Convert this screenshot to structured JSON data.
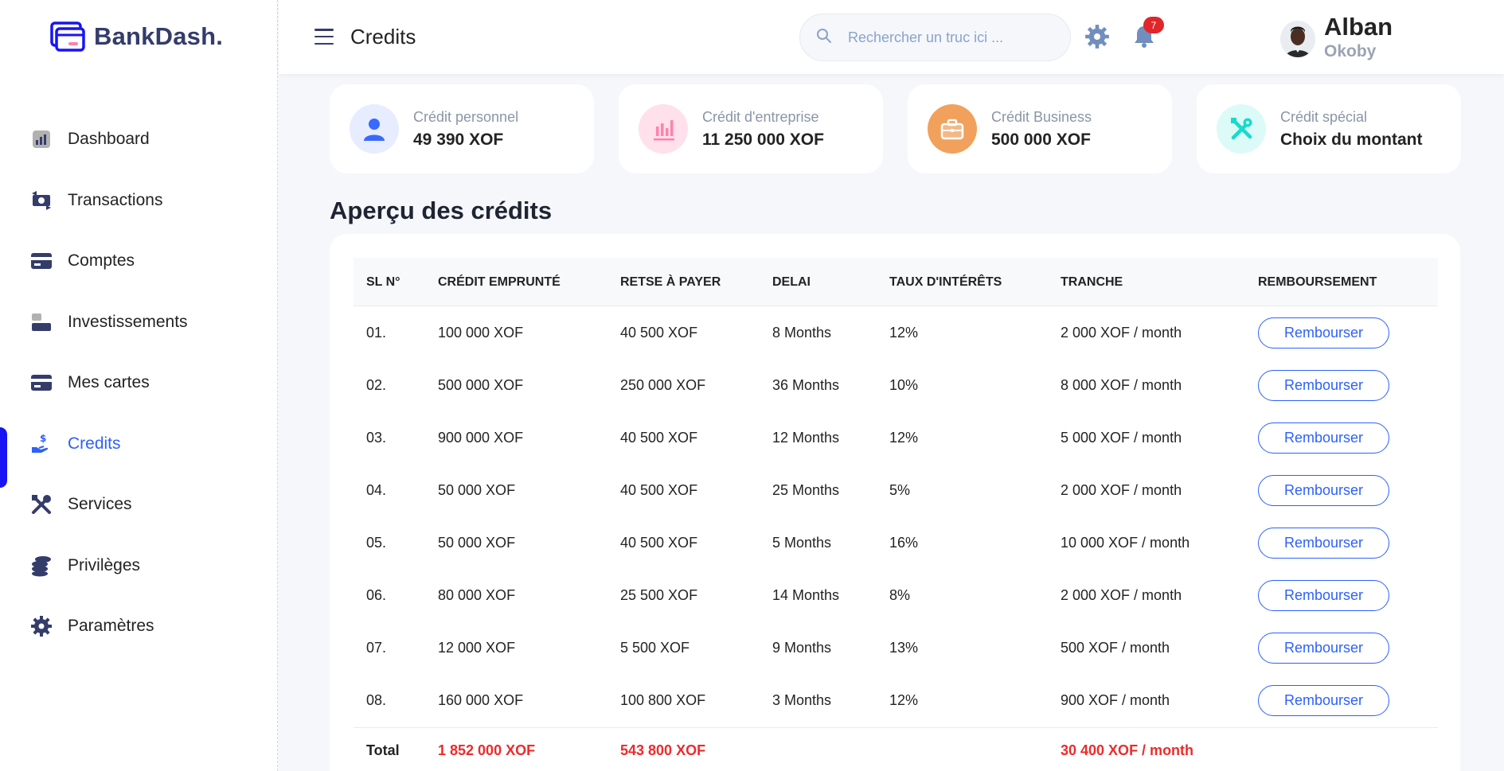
{
  "app": {
    "name": "BankDash."
  },
  "sidebar": {
    "items": [
      {
        "label": "Dashboard",
        "icon": "dashboard-icon"
      },
      {
        "label": "Transactions",
        "icon": "transactions-icon"
      },
      {
        "label": "Comptes",
        "icon": "accounts-icon"
      },
      {
        "label": "Investissements",
        "icon": "investments-icon"
      },
      {
        "label": "Mes cartes",
        "icon": "credit-card-icon"
      },
      {
        "label": "Credits",
        "icon": "loan-icon",
        "active": true
      },
      {
        "label": "Services",
        "icon": "services-icon"
      },
      {
        "label": "Privilèges",
        "icon": "privileges-icon"
      },
      {
        "label": "Paramètres",
        "icon": "settings-icon"
      }
    ]
  },
  "header": {
    "title": "Credits",
    "search_placeholder": "Rechercher un truc ici ...",
    "notification_count": "7",
    "user": {
      "first_name": "Alban",
      "last_name": "Okoby"
    }
  },
  "cards": [
    {
      "label": "Crédit personnel",
      "value": "49 390 XOF",
      "icon": "user-icon",
      "icon_bg": "#e7edff",
      "icon_color": "#396aff"
    },
    {
      "label": "Crédit d'entreprise",
      "value": "11 250 000 XOF",
      "icon": "bar-chart-icon",
      "icon_bg": "#ffe0eb",
      "icon_color": "#ff82ac"
    },
    {
      "label": "Crédit Business",
      "value": "500 000 XOF",
      "icon": "briefcase-icon",
      "icon_bg": "#f1a15c",
      "icon_color": "#ffffff"
    },
    {
      "label": "Crédit spécial",
      "value": "Choix du montant",
      "icon": "tools-icon",
      "icon_bg": "#dcfaf8",
      "icon_color": "#16dbcc"
    }
  ],
  "overview": {
    "title": "Aperçu des crédits",
    "columns": [
      "SL N°",
      "CRÉDIT EMPRUNTÉ",
      "RETSE À PAYER",
      "DELAI",
      "TAUX D'INTÉRÊTS",
      "TRANCHE",
      "REMBOURSEMENT"
    ],
    "button_label": "Rembourser",
    "rows": [
      {
        "sl": "01.",
        "borrowed": "100 000 XOF",
        "remaining": "40 500 XOF",
        "duration": "8 Months",
        "rate": "12%",
        "installment": "2 000 XOF / month"
      },
      {
        "sl": "02.",
        "borrowed": "500 000 XOF",
        "remaining": "250 000 XOF",
        "duration": "36 Months",
        "rate": "10%",
        "installment": "8 000 XOF / month"
      },
      {
        "sl": "03.",
        "borrowed": "900 000 XOF",
        "remaining": "40 500 XOF",
        "duration": "12 Months",
        "rate": "12%",
        "installment": "5 000 XOF / month"
      },
      {
        "sl": "04.",
        "borrowed": "50 000 XOF",
        "remaining": "40 500 XOF",
        "duration": "25 Months",
        "rate": "5%",
        "installment": "2 000 XOF / month"
      },
      {
        "sl": "05.",
        "borrowed": "50 000 XOF",
        "remaining": "40 500 XOF",
        "duration": "5 Months",
        "rate": "16%",
        "installment": "10 000 XOF / month"
      },
      {
        "sl": "06.",
        "borrowed": "80 000 XOF",
        "remaining": "25 500 XOF",
        "duration": "14 Months",
        "rate": "8%",
        "installment": "2 000 XOF / month"
      },
      {
        "sl": "07.",
        "borrowed": "12 000 XOF",
        "remaining": "5 500 XOF",
        "duration": "9 Months",
        "rate": "13%",
        "installment": "500 XOF / month"
      },
      {
        "sl": "08.",
        "borrowed": "160 000 XOF",
        "remaining": "100 800 XOF",
        "duration": "3 Months",
        "rate": "12%",
        "installment": "900 XOF / month"
      }
    ],
    "total": {
      "label": "Total",
      "borrowed": "1 852 000 XOF",
      "remaining": "543 800 XOF",
      "installment": "30 400 XOF / month"
    }
  },
  "colors": {
    "accent": "#2d60ff",
    "active_bar": "#1814f3",
    "total_red": "#ee2a2a",
    "badge_red": "#e0262b"
  }
}
